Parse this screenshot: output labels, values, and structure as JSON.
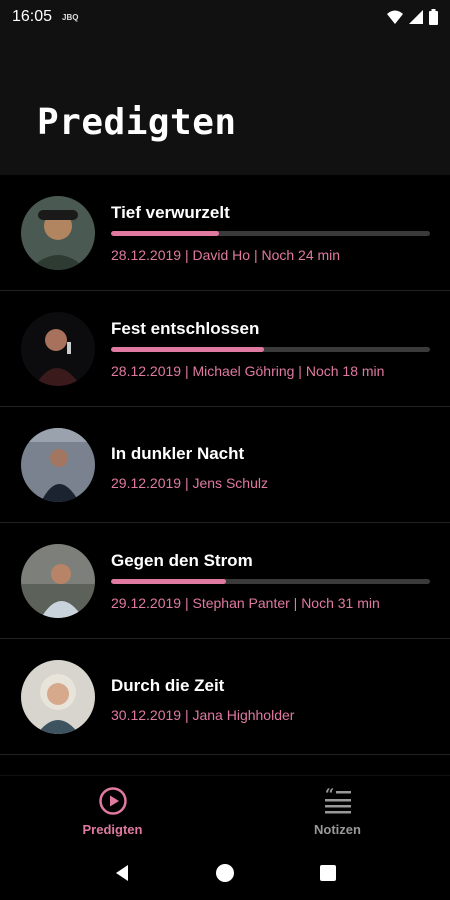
{
  "status_bar": {
    "time": "16:05",
    "extra": "JBQ"
  },
  "header": {
    "title": "Predigten"
  },
  "sermons": [
    {
      "title": "Tief verwurzelt",
      "meta": "28.12.2019 | David Ho | Noch 24 min",
      "progress": 0.34
    },
    {
      "title": "Fest entschlossen",
      "meta": "28.12.2019 | Michael Göhring | Noch 18 min",
      "progress": 0.48
    },
    {
      "title": "In dunkler Nacht",
      "meta": "29.12.2019 | Jens Schulz",
      "progress": null
    },
    {
      "title": "Gegen den Strom",
      "meta": "29.12.2019 | Stephan Panter | Noch 31 min",
      "progress": 0.36
    },
    {
      "title": "Durch die Zeit",
      "meta": "30.12.2019 | Jana Highholder",
      "progress": null
    }
  ],
  "bottom_nav": {
    "tabs": [
      {
        "label": "Predigten",
        "icon": "play-circle-icon",
        "active": true
      },
      {
        "label": "Notizen",
        "icon": "notes-icon",
        "active": false
      }
    ]
  },
  "colors": {
    "accent": "#e07aa0",
    "background": "#000000",
    "header": "#111111"
  }
}
